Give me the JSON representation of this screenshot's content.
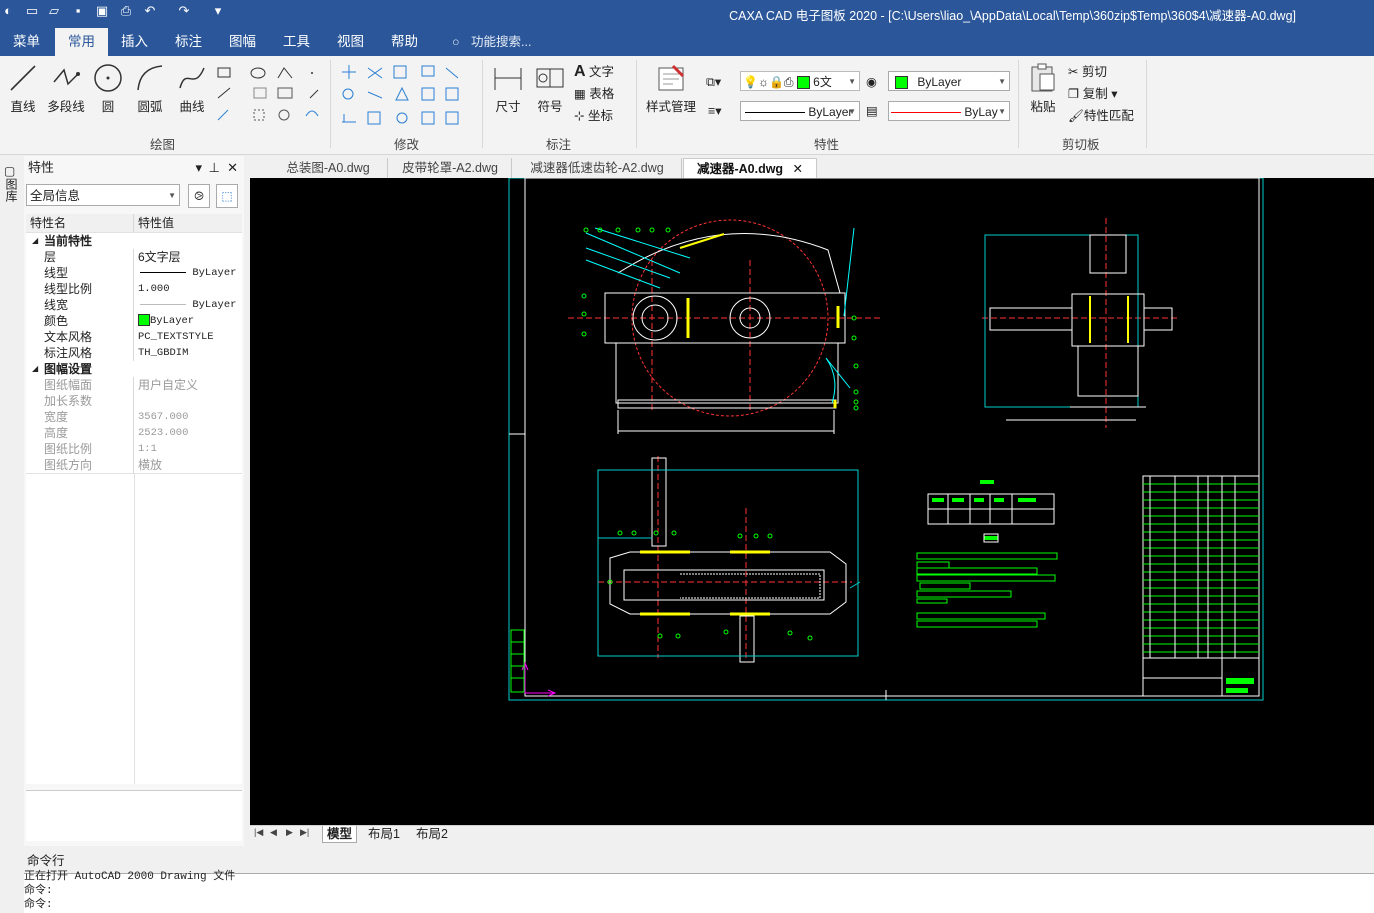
{
  "window": {
    "title": "CAXA CAD 电子图板 2020 - [C:\\Users\\liao_\\AppData\\Local\\Temp\\360zip$Temp\\360$4\\减速器-A0.dwg]"
  },
  "menu": {
    "items": [
      "菜单",
      "常用",
      "插入",
      "标注",
      "图幅",
      "工具",
      "视图",
      "帮助"
    ],
    "active": "常用",
    "search": "功能搜索..."
  },
  "ribbon": {
    "draw": {
      "label": "绘图",
      "line": "直线",
      "polyline": "多段线",
      "circle": "圆",
      "arc": "圆弧",
      "curve": "曲线"
    },
    "modify": {
      "label": "修改"
    },
    "annotate": {
      "label": "标注",
      "dimension": "尺寸",
      "symbol": "符号",
      "text": "文字",
      "table": "表格",
      "coord": "坐标"
    },
    "properties": {
      "label": "特性",
      "style_manage": "样式管理",
      "layer_value": "6文",
      "color_value": "ByLayer",
      "linetype_value": "ByLayer",
      "lineweight_value": "ByLay"
    },
    "clipboard": {
      "label": "剪切板",
      "paste": "粘贴",
      "cut": "剪切",
      "copy": "复制",
      "match": "特性匹配"
    }
  },
  "panel": {
    "title": "特性",
    "selector": "全局信息",
    "col_name": "特性名",
    "col_value": "特性值",
    "side_tab": "图库",
    "rows": [
      {
        "name": "当前特性",
        "value": "",
        "group": true
      },
      {
        "name": "层",
        "value": "6文字层"
      },
      {
        "name": "线型",
        "value": "ByLayer"
      },
      {
        "name": "线型比例",
        "value": "1.000"
      },
      {
        "name": "线宽",
        "value": "ByLayer"
      },
      {
        "name": "颜色",
        "value": "ByLayer"
      },
      {
        "name": "文本风格",
        "value": "PC_TEXTSTYLE"
      },
      {
        "name": "标注风格",
        "value": "TH_GBDIM"
      },
      {
        "name": "图幅设置",
        "value": "",
        "group": true
      },
      {
        "name": "图纸幅面",
        "value": "用户自定义",
        "dim": true
      },
      {
        "name": "加长系数",
        "value": "",
        "dim": true
      },
      {
        "name": "宽度",
        "value": "3567.000",
        "dim": true
      },
      {
        "name": "高度",
        "value": "2523.000",
        "dim": true
      },
      {
        "name": "图纸比例",
        "value": "1:1",
        "dim": true
      },
      {
        "name": "图纸方向",
        "value": "横放",
        "dim": true
      }
    ]
  },
  "doc_tabs": [
    "总装图-A0.dwg",
    "皮带轮罩-A2.dwg",
    "减速器低速齿轮-A2.dwg",
    "减速器-A0.dwg"
  ],
  "active_doc": "减速器-A0.dwg",
  "layout_tabs": [
    "模型",
    "布局1",
    "布局2"
  ],
  "command": {
    "title": "命令行",
    "lines": [
      "正在打开 AutoCAD 2000 Drawing 文件",
      "命令:",
      "命令:"
    ]
  },
  "colors": {
    "titlebar": "#2b579a",
    "canvas": "#000000",
    "frame": "#00cccc",
    "green": "#00ff00",
    "yellow": "#ffff00",
    "red": "#ff0000",
    "white": "#ffffff"
  }
}
